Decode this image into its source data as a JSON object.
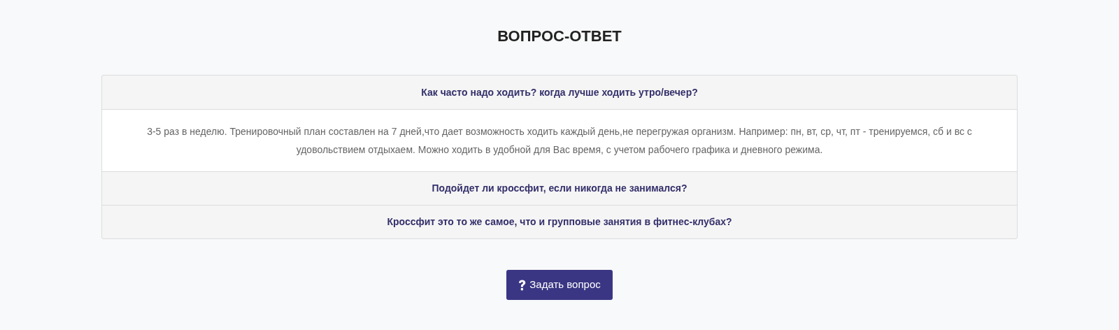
{
  "title": "ВОПРОС-ОТВЕТ",
  "faq": [
    {
      "question": "Как часто надо ходить? когда лучше ходить утро/вечер?",
      "answer": "3-5 раз в неделю. Тренировочный план составлен на 7 дней,что дает возможность ходить каждый день,не перегружая организм. Например: пн, вт, ср, чт, пт - тренируемся, сб и вс с удовольствием отдыхаем. Можно ходить в удобной для Вас время, с учетом рабочего графика и дневного режима."
    },
    {
      "question": "Подойдет ли кроссфит, если никогда не занимался?"
    },
    {
      "question": "Кроссфит это то же самое, что и групповые занятия в фитнес-клубах?"
    }
  ],
  "button": {
    "label": "Задать вопрос"
  }
}
